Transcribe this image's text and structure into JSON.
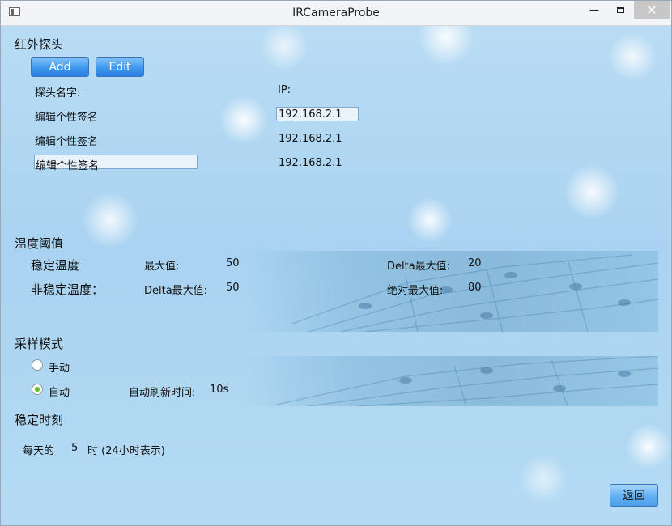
{
  "window": {
    "title": "IRCameraProbe",
    "minimize": "—",
    "close": "✕"
  },
  "probe": {
    "title": "红外探头",
    "add_label": "Add",
    "edit_label": "Edit",
    "col_name": "探头名字:",
    "col_ip": "IP:",
    "rows": [
      {
        "name": "编辑个性签名",
        "ip": "192.168.2.1"
      },
      {
        "name": "编辑个性签名",
        "ip": "192.168.2.1"
      },
      {
        "name": "编辑个性签名",
        "ip": "192.168.2.1"
      }
    ]
  },
  "threshold": {
    "title": "温度阈值",
    "stable_label": "稳定温度",
    "max_label": "最大值:",
    "max_value": "50",
    "delta_max_label": "Delta最大值:",
    "delta_max_value": "20",
    "unstable_label": "非稳定温度：",
    "unstable_delta_label": "Delta最大值:",
    "unstable_delta_value": "50",
    "abs_max_label": "绝对最大值:",
    "abs_max_value": "80"
  },
  "sampling": {
    "title": "采样模式",
    "manual_label": "手动",
    "auto_label": "自动",
    "selected": "auto",
    "refresh_label": "自动刷新时间:",
    "refresh_value": "10s"
  },
  "stable_time": {
    "title": "稳定时刻",
    "daily_label": "每天的",
    "hour_value": "5",
    "hour_suffix": "时 (24小时表示)"
  },
  "back_label": "返回"
}
